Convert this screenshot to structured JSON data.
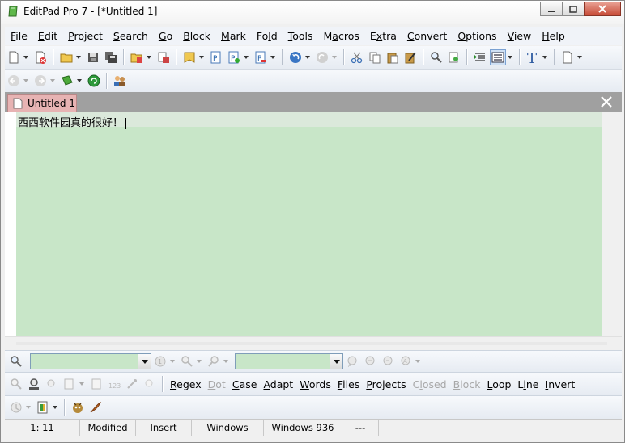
{
  "window": {
    "title": "EditPad Pro 7 - [*Untitled 1]"
  },
  "menu": [
    {
      "pre": "",
      "u": "F",
      "post": "ile"
    },
    {
      "pre": "",
      "u": "E",
      "post": "dit"
    },
    {
      "pre": "",
      "u": "P",
      "post": "roject"
    },
    {
      "pre": "",
      "u": "S",
      "post": "earch"
    },
    {
      "pre": "",
      "u": "G",
      "post": "o"
    },
    {
      "pre": "",
      "u": "B",
      "post": "lock"
    },
    {
      "pre": "",
      "u": "M",
      "post": "ark"
    },
    {
      "pre": "Fo",
      "u": "l",
      "post": "d"
    },
    {
      "pre": "",
      "u": "T",
      "post": "ools"
    },
    {
      "pre": "M",
      "u": "a",
      "post": "cros"
    },
    {
      "pre": "E",
      "u": "x",
      "post": "tra"
    },
    {
      "pre": "",
      "u": "C",
      "post": "onvert"
    },
    {
      "pre": "",
      "u": "O",
      "post": "ptions"
    },
    {
      "pre": "",
      "u": "V",
      "post": "iew"
    },
    {
      "pre": "",
      "u": "H",
      "post": "elp"
    }
  ],
  "tabs": {
    "active_label": "Untitled 1"
  },
  "editor": {
    "text": "西西软件园真的很好！"
  },
  "search_options": [
    {
      "pre": "",
      "u": "R",
      "post": "egex",
      "disabled": false
    },
    {
      "pre": "",
      "u": "D",
      "post": "ot",
      "disabled": true
    },
    {
      "pre": "",
      "u": "C",
      "post": "ase",
      "disabled": false
    },
    {
      "pre": "",
      "u": "A",
      "post": "dapt",
      "disabled": false
    },
    {
      "pre": "",
      "u": "W",
      "post": "ords",
      "disabled": false
    },
    {
      "pre": "",
      "u": "F",
      "post": "iles",
      "disabled": false
    },
    {
      "pre": "",
      "u": "P",
      "post": "rojects",
      "disabled": false
    },
    {
      "pre": "C",
      "u": "l",
      "post": "osed",
      "disabled": true
    },
    {
      "pre": "",
      "u": "B",
      "post": "lock",
      "disabled": true
    },
    {
      "pre": "",
      "u": "L",
      "post": "oop",
      "disabled": false
    },
    {
      "pre": "L",
      "u": "i",
      "post": "ne",
      "disabled": false
    },
    {
      "pre": "",
      "u": "I",
      "post": "nvert",
      "disabled": false
    }
  ],
  "status": {
    "position": "1: 11",
    "modified": "Modified",
    "mode": "Insert",
    "line_breaks": "Windows",
    "encoding": "Windows 936",
    "extra": "---"
  },
  "colors": {
    "editor_bg": "#c8e6c8",
    "tab_active": "#e7b3b3",
    "tabbar": "#a0a0a0"
  }
}
